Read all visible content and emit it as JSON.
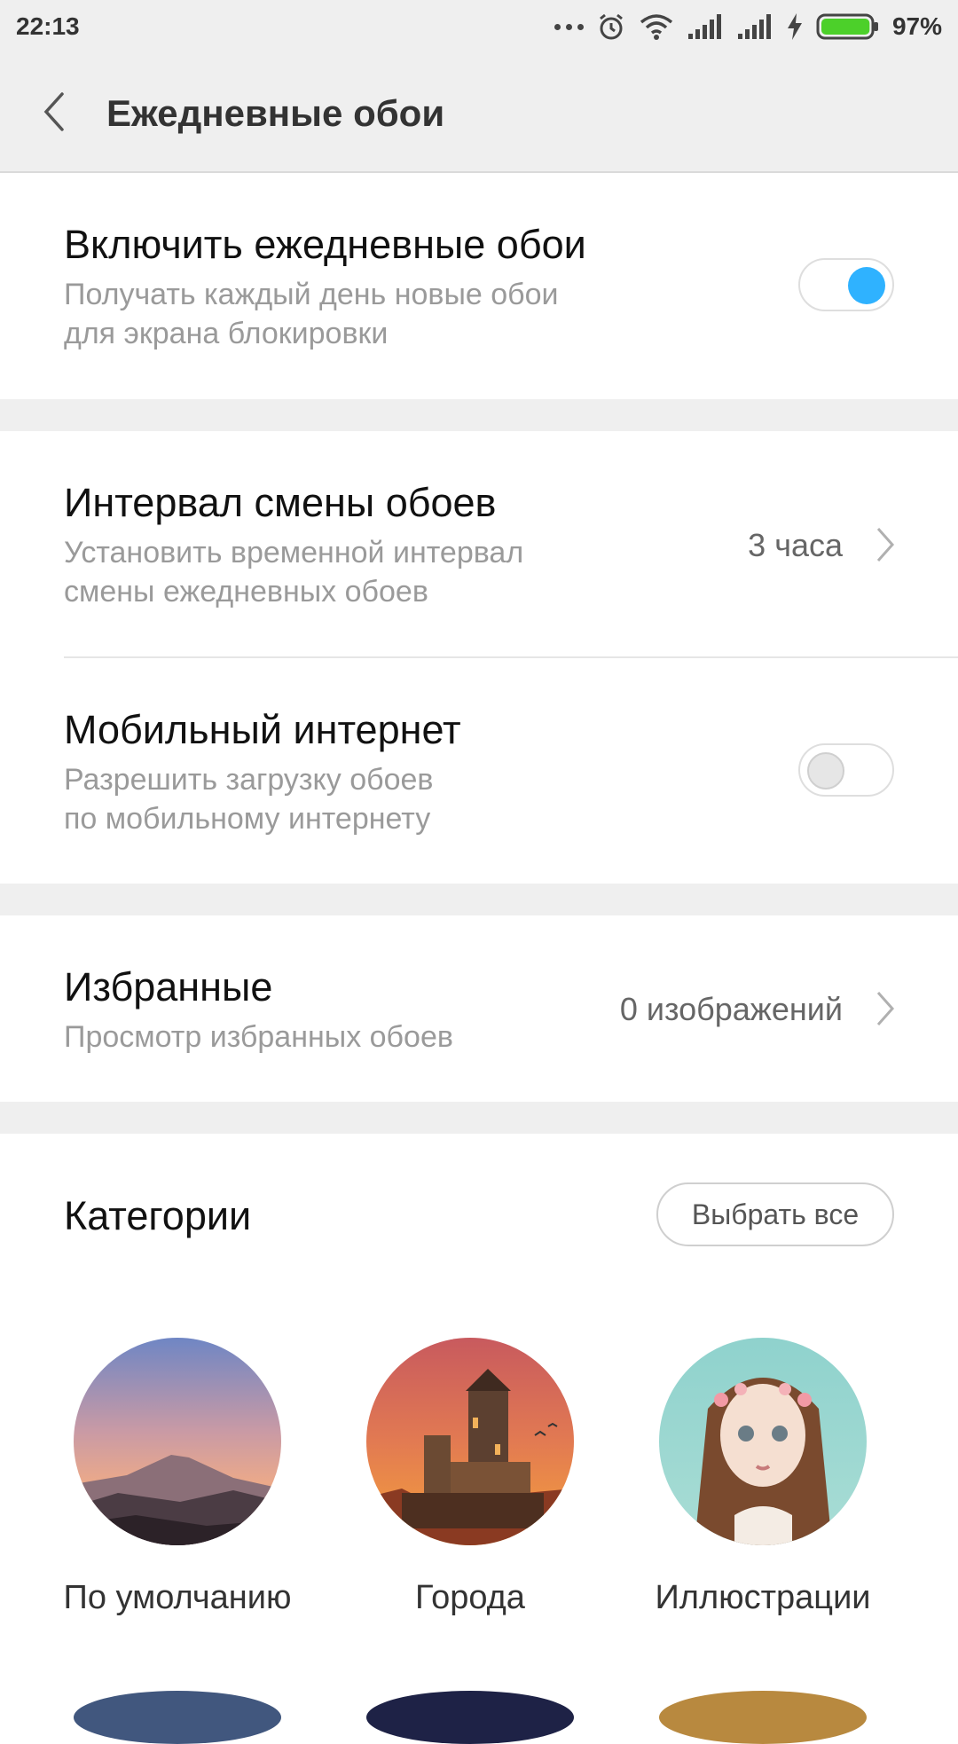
{
  "status_bar": {
    "time": "22:13",
    "battery_percent": "97%",
    "battery_level": 0.97
  },
  "header": {
    "title": "Ежедневные обои"
  },
  "settings": {
    "daily": {
      "title": "Включить ежедневные обои",
      "subtitle": "Получать каждый день новые обои\nдля экрана блокировки",
      "enabled": true
    },
    "interval": {
      "title": "Интервал смены обоев",
      "subtitle": "Установить временной интервал\nсмены ежедневных обоев",
      "value": "3 часа"
    },
    "mobile": {
      "title": "Мобильный интернет",
      "subtitle": "Разрешить загрузку обоев\nпо мобильному интернету",
      "enabled": false
    },
    "favorites": {
      "title": "Избранные",
      "subtitle": "Просмотр избранных обоев",
      "value": "0 изображений"
    }
  },
  "categories": {
    "title": "Категории",
    "select_all": "Выбрать все",
    "items": [
      {
        "label": "По умолчанию",
        "icon": "mountain-sunset-thumbnail"
      },
      {
        "label": "Города",
        "icon": "castle-tower-thumbnail"
      },
      {
        "label": "Иллюстрации",
        "icon": "girl-illustration-thumbnail"
      }
    ]
  },
  "colors": {
    "accent": "#2fb2ff",
    "battery": "#4cd02a",
    "background_gray": "#efefef"
  }
}
